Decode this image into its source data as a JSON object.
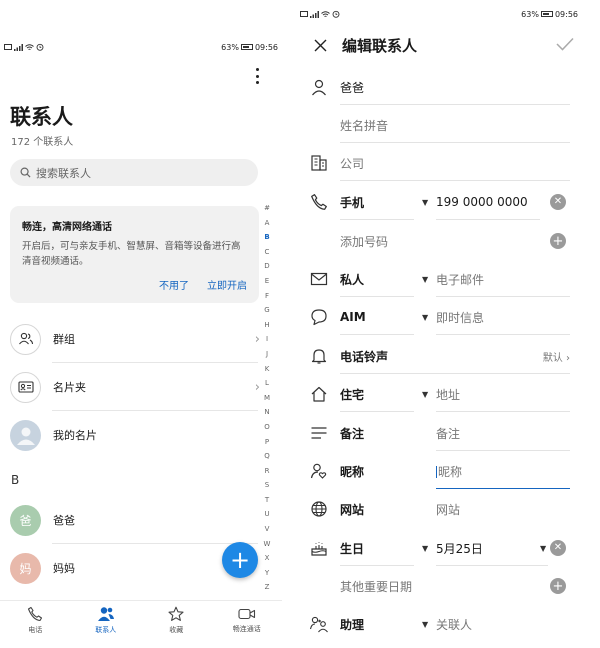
{
  "status": {
    "battery": "63%",
    "time": "09:56"
  },
  "contacts": {
    "title": "联系人",
    "count": "172 个联系人",
    "search_placeholder": "搜索联系人",
    "promo": {
      "title": "畅连，高清网络通话",
      "body": "开启后，可与亲友手机、智慧屏、音箱等设备进行高清音视频通话。",
      "dismiss": "不用了",
      "enable": "立即开启"
    },
    "alphabet": [
      "#",
      "A",
      "B",
      "C",
      "D",
      "E",
      "F",
      "G",
      "H",
      "I",
      "J",
      "K",
      "L",
      "M",
      "N",
      "O",
      "P",
      "Q",
      "R",
      "S",
      "T",
      "U",
      "V",
      "W",
      "X",
      "Y",
      "Z"
    ],
    "active_letter": "B",
    "rows": {
      "groups": "群组",
      "cards": "名片夹",
      "my_card": "我的名片"
    },
    "section": "B",
    "list": [
      {
        "avatar": "爸",
        "name": "爸爸",
        "color": "#a9ccae"
      },
      {
        "avatar": "妈",
        "name": "妈妈",
        "color": "#e8b9ab"
      }
    ],
    "fab": "+",
    "nav": [
      "电话",
      "联系人",
      "收藏",
      "畅连通话"
    ]
  },
  "edit": {
    "title": "编辑联系人",
    "name": "爸爸",
    "phonetic_placeholder": "姓名拼音",
    "company_placeholder": "公司",
    "phone_label": "手机",
    "phone_value": "199 0000 0000",
    "add_number": "添加号码",
    "email_label": "私人",
    "email_placeholder": "电子邮件",
    "im_label": "AIM",
    "im_placeholder": "即时信息",
    "ringtone_label": "电话铃声",
    "ringtone_value": "默认",
    "address_label": "住宅",
    "address_placeholder": "地址",
    "note_label": "备注",
    "note_placeholder": "备注",
    "nickname_label": "昵称",
    "nickname_placeholder": "昵称",
    "website_label": "网站",
    "website_placeholder": "网站",
    "birthday_label": "生日",
    "birthday_value": "5月25日",
    "other_dates": "其他重要日期",
    "assistant_label": "助理",
    "assistant_placeholder": "关联人"
  }
}
